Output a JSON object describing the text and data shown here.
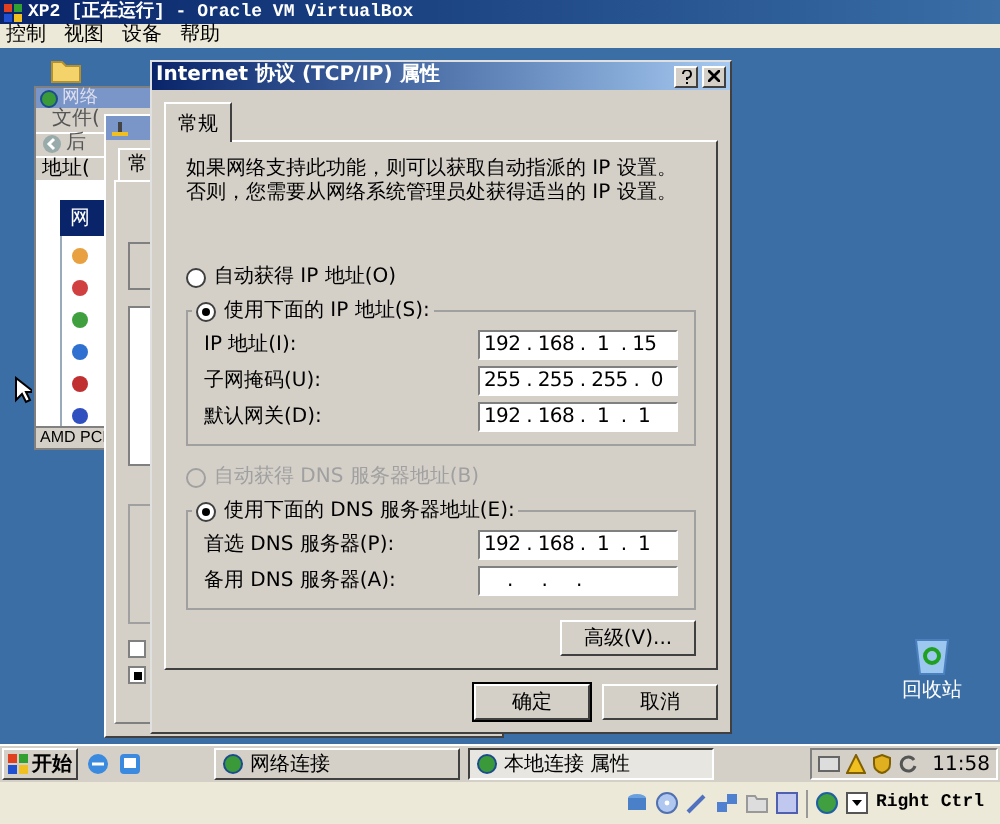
{
  "vbox": {
    "title": "XP2 [正在运行] - Oracle VM VirtualBox",
    "menu": [
      "控制",
      "视图",
      "设备",
      "帮助"
    ],
    "host_key": "Right Ctrl"
  },
  "back_window": {
    "title": "网络",
    "menu": "文件(",
    "back": "后",
    "address": "地址(",
    "panel_header": "网",
    "status": "AMD PCI"
  },
  "middle_window": {
    "tab": "常",
    "checkboxes": [
      {
        "checked": false
      },
      {
        "checked": true
      }
    ]
  },
  "dialog": {
    "title": "Internet 协议 (TCP/IP) 属性",
    "tabs": [
      {
        "label": "常规",
        "selected": true
      }
    ],
    "description": "如果网络支持此功能，则可以获取自动指派的 IP 设置。否则，您需要从网络系统管理员处获得适当的 IP 设置。",
    "ip_options": [
      {
        "label": "自动获得 IP 地址(O)",
        "selected": false,
        "disabled": false
      },
      {
        "label": "使用下面的 IP 地址(S):",
        "selected": true,
        "disabled": false
      }
    ],
    "ip_fields": [
      {
        "label": "IP 地址(I):",
        "value": "192 . 168 .  1  . 15"
      },
      {
        "label": "子网掩码(U):",
        "value": "255 . 255 . 255 .  0"
      },
      {
        "label": "默认网关(D):",
        "value": "192 . 168 .  1  .  1"
      }
    ],
    "dns_options": [
      {
        "label": "自动获得 DNS 服务器地址(B)",
        "selected": false,
        "disabled": true
      },
      {
        "label": "使用下面的 DNS 服务器地址(E):",
        "selected": true,
        "disabled": false
      }
    ],
    "dns_fields": [
      {
        "label": "首选 DNS 服务器(P):",
        "value": "192 . 168 .  1  .  1"
      },
      {
        "label": "备用 DNS 服务器(A):",
        "value": "    .     .     ."
      }
    ],
    "advanced_button": "高级(V)...",
    "ok_button": "确定",
    "cancel_button": "取消"
  },
  "desktop_icons": [
    {
      "label": "回收站"
    }
  ],
  "taskbar": {
    "start": "开始",
    "tasks": [
      {
        "label": "网络连接",
        "selected": false
      },
      {
        "label": "本地连接 属性",
        "selected": true
      }
    ],
    "clock": "11:58"
  }
}
